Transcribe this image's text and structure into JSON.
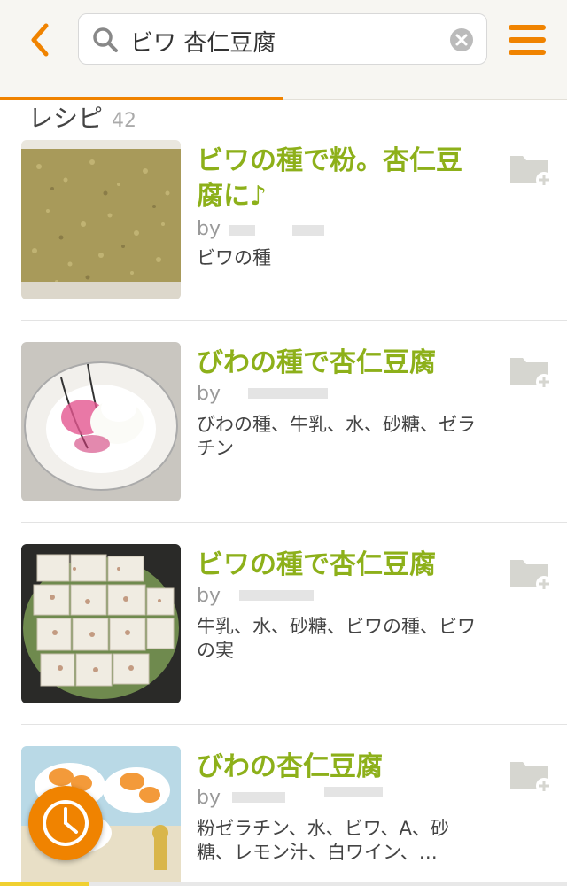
{
  "header": {
    "search_value": "ビワ 杏仁豆腐",
    "icons": {
      "back": "chevron-left-icon",
      "search": "search-icon",
      "clear": "clear-icon",
      "menu": "hamburger-menu-icon"
    },
    "accent_color": "#f08300"
  },
  "section": {
    "label": "レシピ",
    "count": "42"
  },
  "recipes": [
    {
      "title": "ビワの種で粉。杏仁豆腐に♪",
      "by": "by",
      "ingredients": "ビワの種"
    },
    {
      "title": "びわの種で杏仁豆腐",
      "by": "by",
      "ingredients": "びわの種、牛乳、水、砂糖、ゼラチン"
    },
    {
      "title": "ビワの種で杏仁豆腐",
      "by": "by",
      "ingredients": "牛乳、水、砂糖、ビワの種、ビワの実"
    },
    {
      "title": "びわの杏仁豆腐",
      "by": "by",
      "ingredients": "粉ゼラチン、水、ビワ、A、砂糖、レモン汁、白ワイン、…"
    }
  ],
  "colors": {
    "title_green": "#8db01a",
    "accent": "#f08300"
  }
}
